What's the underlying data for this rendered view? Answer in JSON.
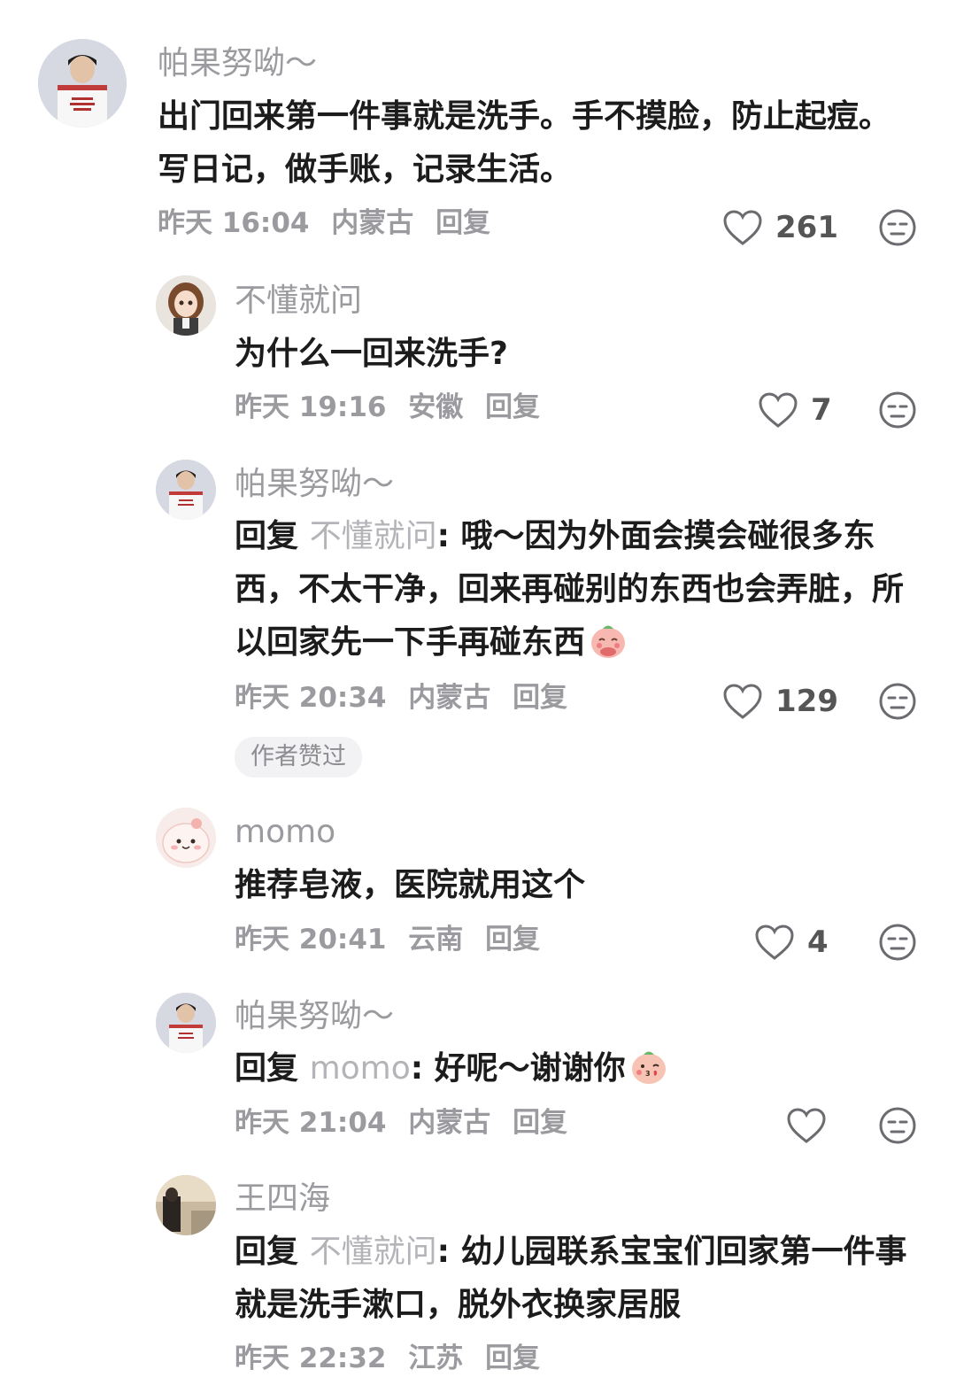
{
  "comments": [
    {
      "username": "帕果努呦～",
      "text": "出门回来第一件事就是洗手。手不摸脸，防止起痘。写日记，做手账，记录生活。",
      "time": "昨天 16:04",
      "location": "内蒙古",
      "reply_label": "回复",
      "likes": "261",
      "avatar": "boy-white-shirt"
    },
    {
      "username": "不懂就问",
      "text": "为什么一回来洗手?",
      "time": "昨天 19:16",
      "location": "安徽",
      "reply_label": "回复",
      "likes": "7",
      "avatar": "cartoon-girl"
    },
    {
      "username": "帕果努呦～",
      "reply_prefix": "回复",
      "mention": "不懂就问",
      "text": ": 哦～因为外面会摸会碰很多东西，不太干净，回来再碰别的东西也会弄脏，所以回家先一下手再碰东西",
      "time": "昨天 20:34",
      "location": "内蒙古",
      "reply_label": "回复",
      "likes": "129",
      "badge": "作者赞过",
      "avatar": "boy-white-shirt",
      "emoji": "peach-shy-face"
    },
    {
      "username": "momo",
      "text": "推荐皂液，医院就用这个",
      "time": "昨天 20:41",
      "location": "云南",
      "reply_label": "回复",
      "likes": "4",
      "avatar": "pink-blob"
    },
    {
      "username": "帕果努呦～",
      "reply_prefix": "回复",
      "mention": "momo",
      "text": ": 好呢～谢谢你",
      "time": "昨天 21:04",
      "location": "内蒙古",
      "reply_label": "回复",
      "likes": "",
      "avatar": "boy-white-shirt",
      "emoji": "peach-kiss-face"
    },
    {
      "username": "王四海",
      "reply_prefix": "回复",
      "mention": "不懂就问",
      "text": ": 幼儿园联系宝宝们回家第一件事就是洗手漱口，脱外衣换家居服",
      "time": "昨天 22:32",
      "location": "江苏",
      "reply_label": "回复",
      "avatar": "dark-photo"
    }
  ],
  "colors": {
    "secondary_text": "#9a9a9f",
    "primary_text": "#1c1c1c",
    "badge_bg": "#f2f2f4"
  },
  "icons": {
    "like": "heart-outline-icon",
    "dislike": "meh-face-icon"
  }
}
